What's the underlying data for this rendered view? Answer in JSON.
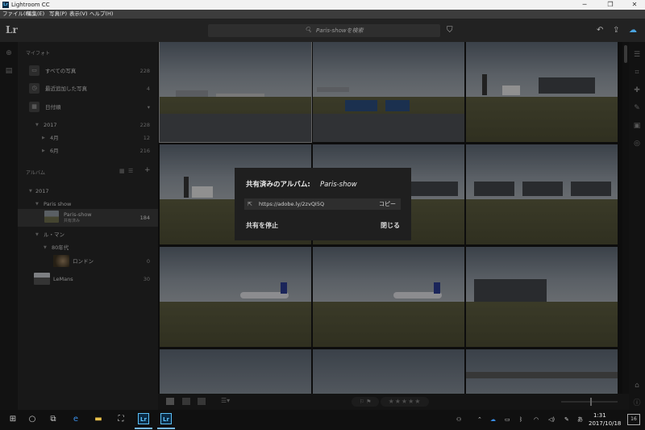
{
  "window": {
    "title": "Lightroom CC",
    "logo": "Lr"
  },
  "menu": [
    "ファイル(F)",
    "編集(E)",
    "写真(P)",
    "表示(V)",
    "ヘルプ(H)"
  ],
  "search": {
    "placeholder": "Paris-showを検索"
  },
  "sidebar": {
    "my_photos_header": "マイフォト",
    "items": [
      {
        "label": "すべての写真",
        "count": "228"
      },
      {
        "label": "最近追加した写真",
        "count": "4"
      },
      {
        "label": "日付順",
        "count": ""
      }
    ],
    "dates": [
      {
        "label": "2017",
        "count": "228"
      },
      {
        "label": "4月",
        "count": "12"
      },
      {
        "label": "6月",
        "count": "216"
      }
    ],
    "albums_header": "アルバム",
    "albums": [
      {
        "label": "2017",
        "count": ""
      },
      {
        "label": "Paris show",
        "count": ""
      },
      {
        "label": "Paris-show",
        "count": "184",
        "sublabel": "共有済み"
      },
      {
        "label": "ル・マン",
        "count": ""
      },
      {
        "label": "80年代",
        "count": ""
      },
      {
        "label": "ロンドン",
        "count": "0"
      },
      {
        "label": "LeMans",
        "count": "30"
      }
    ]
  },
  "dialog": {
    "title": "共有済みのアルバム:",
    "album_name": "Paris-show",
    "url": "https://adobe.ly/2zvQI5Q",
    "copy_label": "コピー",
    "stop_sharing_label": "共有を停止",
    "close_label": "閉じる"
  },
  "bottombar": {
    "stars": "★★★★★",
    "flags": "⚐ ⚑"
  },
  "taskbar": {
    "time": "1:31",
    "date": "2017/10/18",
    "ime": "あ",
    "notifications": "16"
  }
}
